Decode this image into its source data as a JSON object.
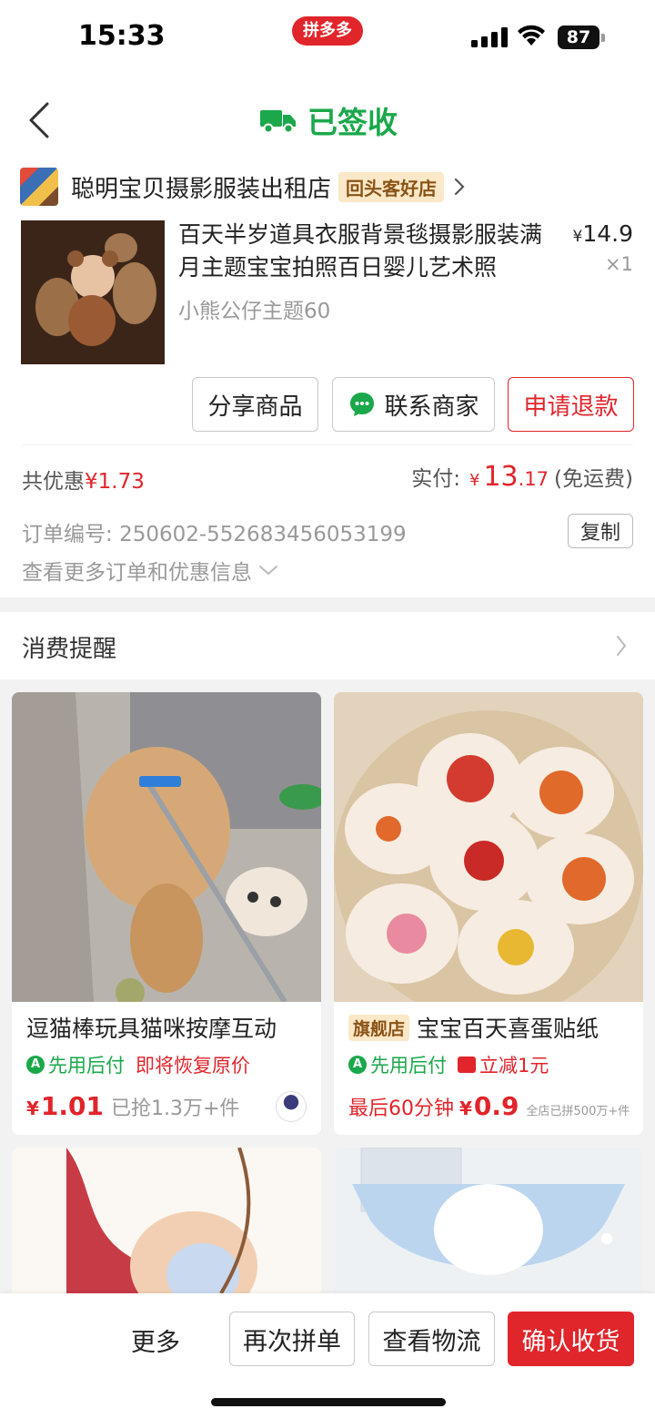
{
  "status_bar": {
    "time": "15:33",
    "app_badge": "拼多多",
    "battery": "87"
  },
  "header": {
    "status_title": "已签收"
  },
  "shop": {
    "name": "聪明宝贝摄影服装出租店",
    "badge": "回头客好店"
  },
  "product": {
    "title": "百天半岁道具衣服背景毯摄影服装满月主题宝宝拍照百日婴儿艺术照",
    "spec": "小熊公仔主题60",
    "currency": "¥",
    "price": "14.9",
    "qty": "×1"
  },
  "actions": {
    "share": "分享商品",
    "contact": "联系商家",
    "refund": "申请退款"
  },
  "summary": {
    "discount_label": "共优惠",
    "discount_value": "¥1.73",
    "paid_label": "实付:",
    "paid_currency": "¥",
    "paid_int": "13",
    "paid_dec": ".17",
    "shipping": "(免运费)"
  },
  "order": {
    "number_label": "订单编号:",
    "number": "250602-552683456053199",
    "copy": "复制",
    "more_info": "查看更多订单和优惠信息"
  },
  "reminder": {
    "title": "消费提醒"
  },
  "feed": [
    {
      "title": "逗猫棒玩具猫咪按摩互动",
      "flag": "",
      "tag1": "先用后付",
      "tag2": "即将恢复原价",
      "price_currency": "¥",
      "price": "1.01",
      "sold": "已抢1.3万+件"
    },
    {
      "title": "宝宝百天喜蛋贴纸",
      "flag": "旗舰店",
      "tag1": "先用后付",
      "tag2": "立减1元",
      "urgency": "最后60分钟",
      "price_currency": "¥",
      "price": "0.9",
      "sold": "全店已拼500万+件"
    }
  ],
  "bottom_bar": {
    "more": "更多",
    "reorder": "再次拼单",
    "track": "查看物流",
    "confirm": "确认收货"
  },
  "colors": {
    "accent_red": "#e0252b",
    "accent_green": "#1aa84a",
    "badge_bg": "#fbe8c8"
  }
}
